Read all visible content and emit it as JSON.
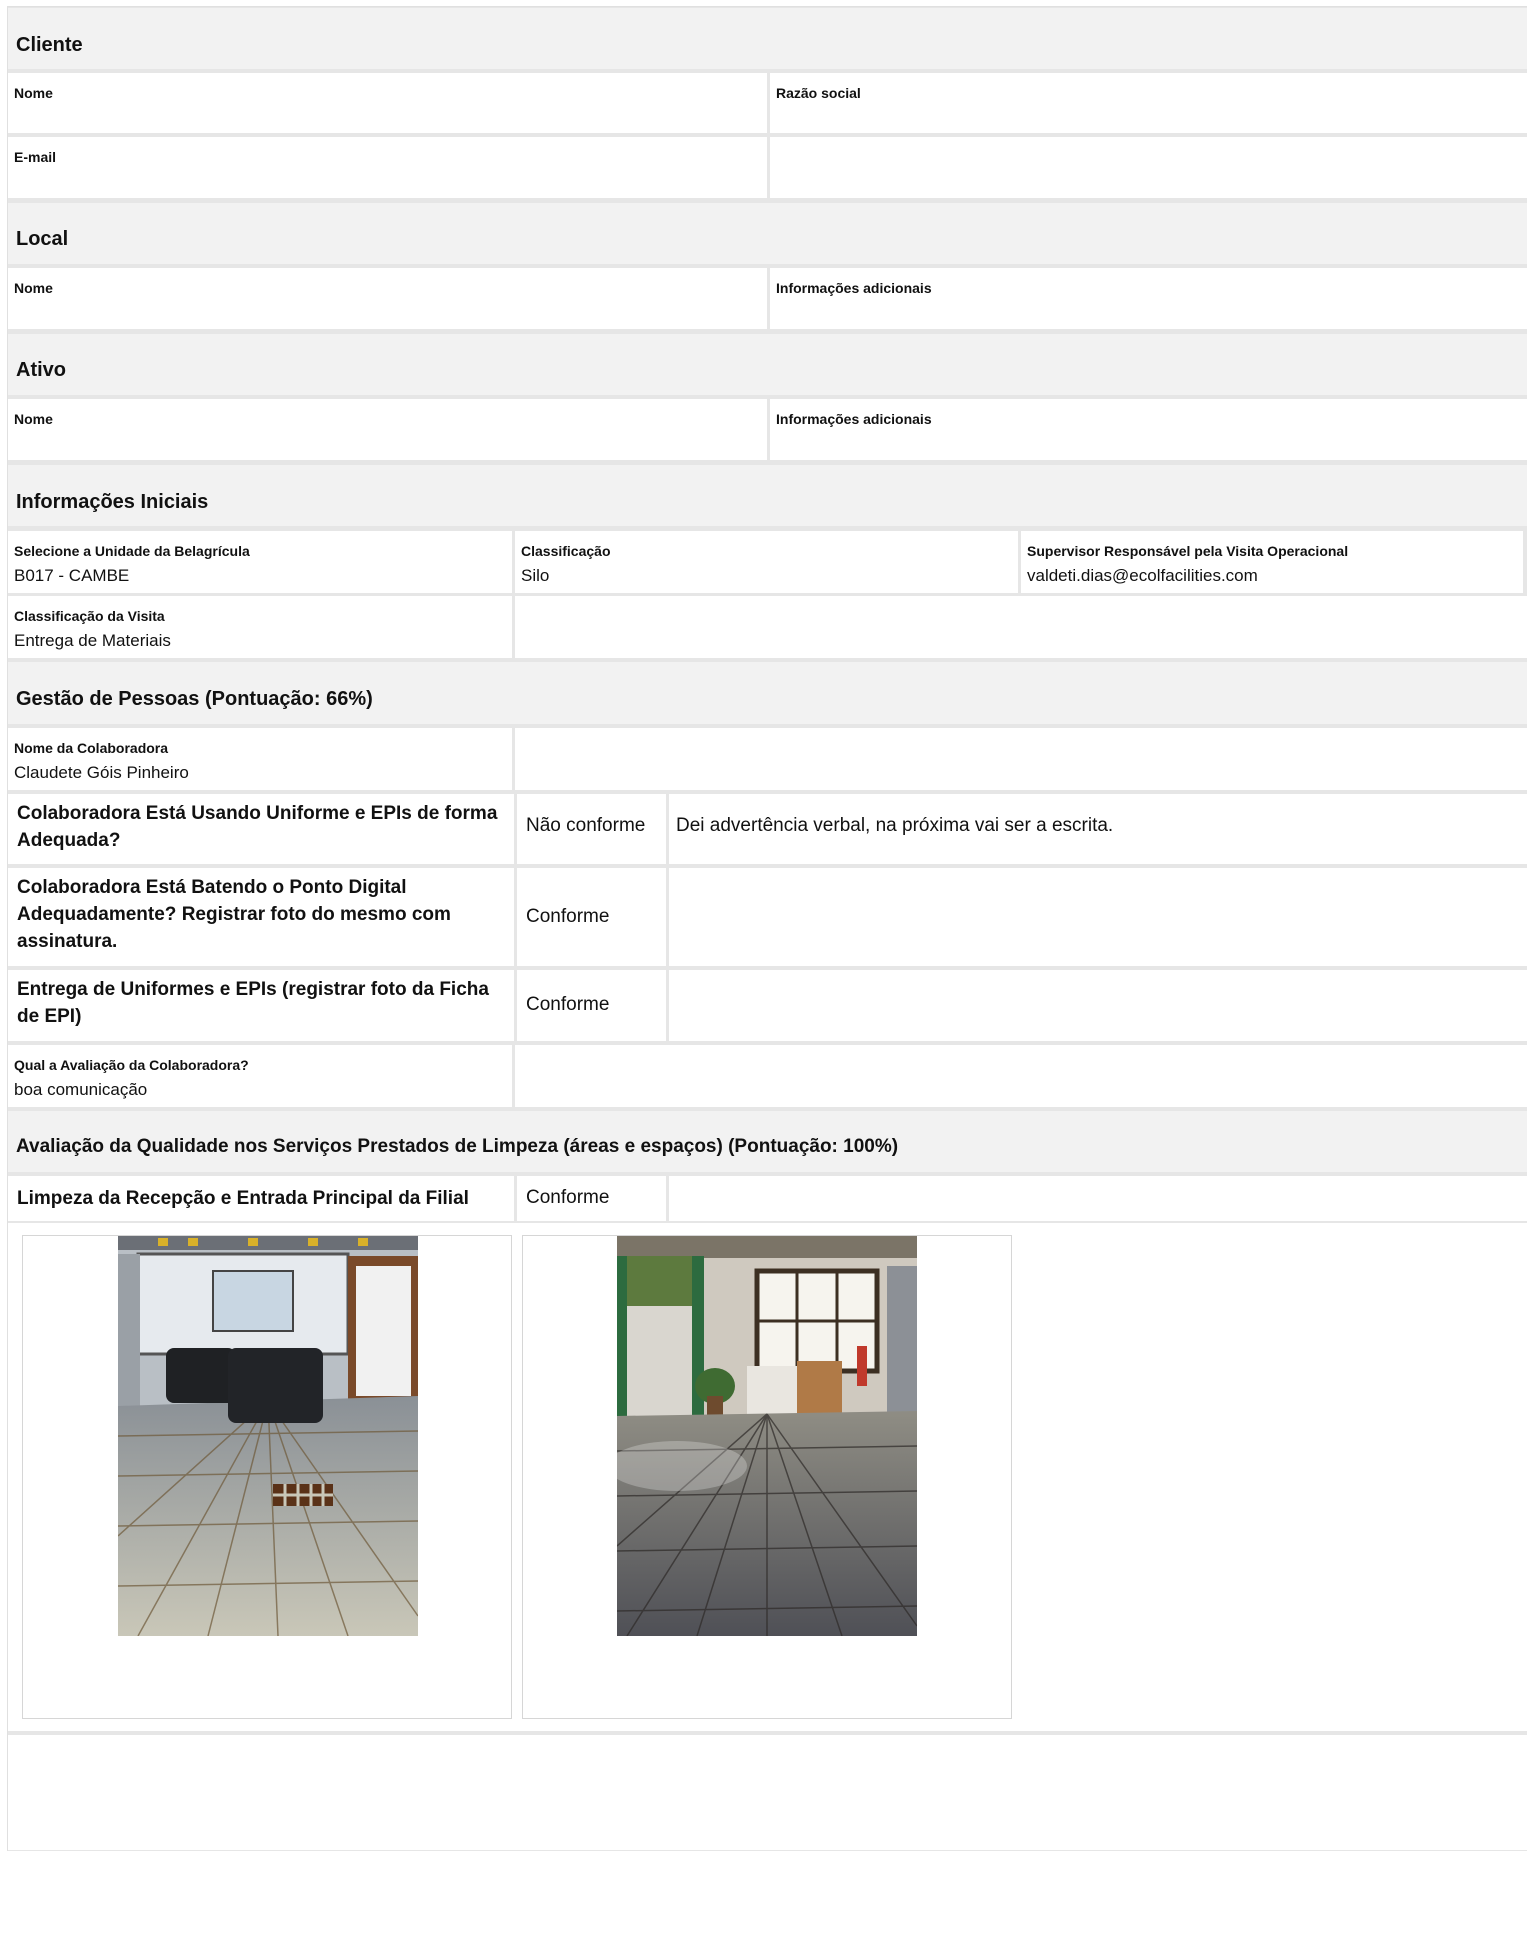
{
  "cliente": {
    "title": "Cliente",
    "nome_label": "Nome",
    "razao_label": "Razão social",
    "email_label": "E-mail"
  },
  "local": {
    "title": "Local",
    "nome_label": "Nome",
    "info_label": "Informações adicionais"
  },
  "ativo": {
    "title": "Ativo",
    "nome_label": "Nome",
    "info_label": "Informações adicionais"
  },
  "iniciais": {
    "title": "Informações Iniciais",
    "unidade_label": "Selecione a Unidade da Belagrícula",
    "unidade_value": "B017 - CAMBE",
    "classificacao_label": "Classificação",
    "classificacao_value": "Silo",
    "supervisor_label": "Supervisor Responsável pela Visita Operacional",
    "supervisor_value": "valdeti.dias@ecolfacilities.com",
    "visita_label": "Classificação da Visita",
    "visita_value": "Entrega de Materiais"
  },
  "pessoas": {
    "title": "Gestão de Pessoas (Pontuação: 66%)",
    "colab_label": "Nome da Colaboradora",
    "colab_value": "Claudete Góis Pinheiro",
    "q1_line1": "Colaboradora Está Usando Uniforme e EPIs de forma",
    "q1_line2": "Adequada?",
    "q1_answer": "Não conforme",
    "q1_comment": "Dei advertência verbal, na próxima vai ser a escrita.",
    "q2_line1": "Colaboradora Está Batendo o Ponto Digital",
    "q2_line2": "Adequadamente? Registrar foto do mesmo com",
    "q2_line3": "assinatura.",
    "q2_answer": "Conforme",
    "q3_line1": "Entrega de Uniformes e EPIs (registrar foto da Ficha",
    "q3_line2": "de EPI)",
    "q3_answer": "Conforme",
    "avaliacao_label": "Qual a Avaliação da Colaboradora?",
    "avaliacao_value": "boa comunicação"
  },
  "limpeza": {
    "title": "Avaliação da Qualidade nos Serviços Prestados de Limpeza (áreas e espaços) (Pontuação: 100%)",
    "q1": "Limpeza da Recepção e Entrada Principal da Filial",
    "q1_answer": "Conforme"
  }
}
